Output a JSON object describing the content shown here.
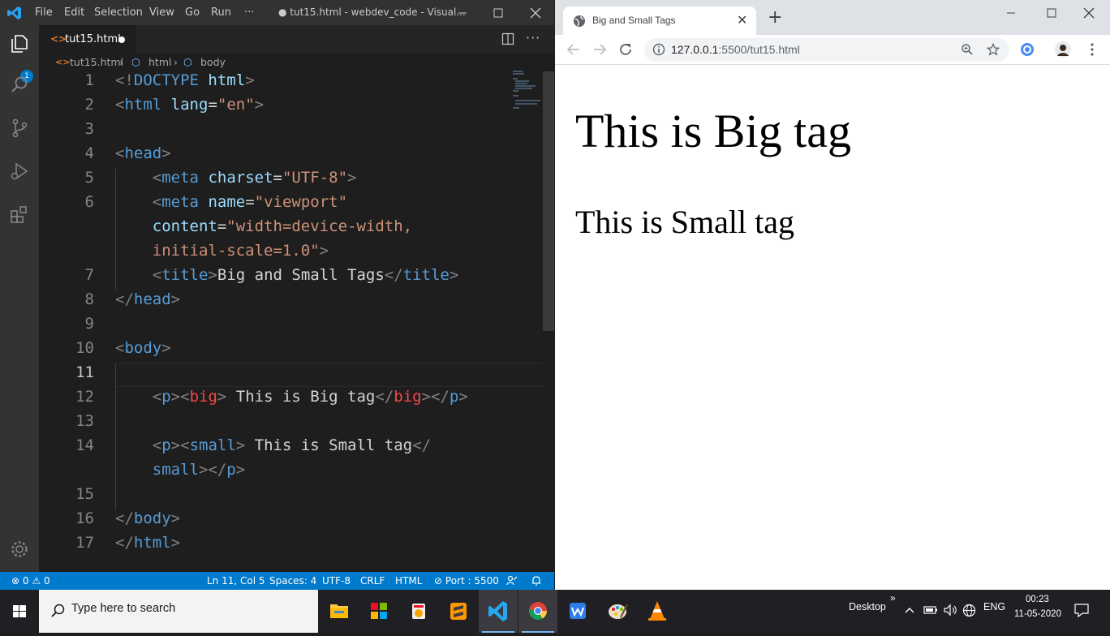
{
  "vscode": {
    "menu": [
      "File",
      "Edit",
      "Selection",
      "View",
      "Go",
      "Run",
      "···"
    ],
    "window_title": "● tut15.html - webdev_code - Visual...",
    "tab_label": "tut15.html",
    "explorer_badge": "1",
    "breadcrumb": [
      "tut15.html",
      "html",
      "body"
    ],
    "line_numbers": [
      "1",
      "2",
      "3",
      "4",
      "5",
      "6",
      "",
      "",
      "7",
      "8",
      "9",
      "10",
      "11",
      "12",
      "13",
      "14",
      "",
      "15",
      "16",
      "17"
    ],
    "status": {
      "errors": "0",
      "warnings": "0",
      "position": "Ln 11, Col 5",
      "spaces": "Spaces: 4",
      "encoding": "UTF-8",
      "eol": "CRLF",
      "language": "HTML",
      "port": "Port : 5500"
    }
  },
  "code_lines": [
    [
      [
        "t-punc",
        "<!"
      ],
      [
        "t-tag",
        "DOCTYPE"
      ],
      [
        "t-txt",
        " "
      ],
      [
        "t-attr",
        "html"
      ],
      [
        "t-punc",
        ">"
      ]
    ],
    [
      [
        "t-punc",
        "<"
      ],
      [
        "t-tag",
        "html"
      ],
      [
        "t-txt",
        " "
      ],
      [
        "t-attr",
        "lang"
      ],
      [
        "t-txt",
        "="
      ],
      [
        "t-str",
        "\"en\""
      ],
      [
        "t-punc",
        ">"
      ]
    ],
    [],
    [
      [
        "t-punc",
        "<"
      ],
      [
        "t-tag",
        "head"
      ],
      [
        "t-punc",
        ">"
      ]
    ],
    [
      [
        "t-txt",
        "    "
      ],
      [
        "t-punc",
        "<"
      ],
      [
        "t-tag",
        "meta"
      ],
      [
        "t-txt",
        " "
      ],
      [
        "t-attr",
        "charset"
      ],
      [
        "t-txt",
        "="
      ],
      [
        "t-str",
        "\"UTF-8\""
      ],
      [
        "t-punc",
        ">"
      ]
    ],
    [
      [
        "t-txt",
        "    "
      ],
      [
        "t-punc",
        "<"
      ],
      [
        "t-tag",
        "meta"
      ],
      [
        "t-txt",
        " "
      ],
      [
        "t-attr",
        "name"
      ],
      [
        "t-txt",
        "="
      ],
      [
        "t-str",
        "\"viewport\""
      ]
    ],
    [
      [
        "t-txt",
        "    "
      ],
      [
        "t-attr",
        "content"
      ],
      [
        "t-txt",
        "="
      ],
      [
        "t-str",
        "\"width=device-width,"
      ]
    ],
    [
      [
        "t-txt",
        "    "
      ],
      [
        "t-str",
        "initial-scale=1.0\""
      ],
      [
        "t-punc",
        ">"
      ]
    ],
    [
      [
        "t-txt",
        "    "
      ],
      [
        "t-punc",
        "<"
      ],
      [
        "t-tag",
        "title"
      ],
      [
        "t-punc",
        ">"
      ],
      [
        "t-txt",
        "Big and Small Tags"
      ],
      [
        "t-punc",
        "</"
      ],
      [
        "t-tag",
        "title"
      ],
      [
        "t-punc",
        ">"
      ]
    ],
    [
      [
        "t-punc",
        "</"
      ],
      [
        "t-tag",
        "head"
      ],
      [
        "t-punc",
        ">"
      ]
    ],
    [],
    [
      [
        "t-punc",
        "<"
      ],
      [
        "t-tag",
        "body"
      ],
      [
        "t-punc",
        ">"
      ]
    ],
    [],
    [
      [
        "t-txt",
        "    "
      ],
      [
        "t-punc",
        "<"
      ],
      [
        "t-tag",
        "p"
      ],
      [
        "t-punc",
        "><"
      ],
      [
        "t-red",
        "big"
      ],
      [
        "t-punc",
        ">"
      ],
      [
        "t-txt",
        " This is Big tag"
      ],
      [
        "t-punc",
        "</"
      ],
      [
        "t-red",
        "big"
      ],
      [
        "t-punc",
        "></"
      ],
      [
        "t-tag",
        "p"
      ],
      [
        "t-punc",
        ">"
      ]
    ],
    [],
    [
      [
        "t-txt",
        "    "
      ],
      [
        "t-punc",
        "<"
      ],
      [
        "t-tag",
        "p"
      ],
      [
        "t-punc",
        "><"
      ],
      [
        "t-tag",
        "small"
      ],
      [
        "t-punc",
        ">"
      ],
      [
        "t-txt",
        " This is Small tag"
      ],
      [
        "t-punc",
        "</"
      ]
    ],
    [
      [
        "t-txt",
        "    "
      ],
      [
        "t-tag",
        "small"
      ],
      [
        "t-punc",
        "></"
      ],
      [
        "t-tag",
        "p"
      ],
      [
        "t-punc",
        ">"
      ]
    ],
    [],
    [
      [
        "t-punc",
        "</"
      ],
      [
        "t-tag",
        "body"
      ],
      [
        "t-punc",
        ">"
      ]
    ],
    [
      [
        "t-punc",
        "</"
      ],
      [
        "t-tag",
        "html"
      ],
      [
        "t-punc",
        ">"
      ]
    ]
  ],
  "chrome": {
    "tab_title": "Big and Small Tags",
    "url_host": "127.0.0.1",
    "url_rest": ":5500/tut15.html",
    "page": {
      "big": "This is Big tag",
      "small": "This is Small tag"
    }
  },
  "taskbar": {
    "search_placeholder": "Type here to search",
    "desktop_label": "Desktop",
    "chevron": "»",
    "lang": "ENG",
    "time": "00:23",
    "date": "11-05-2020"
  }
}
